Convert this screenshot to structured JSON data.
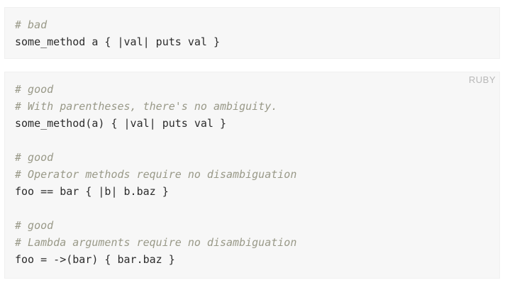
{
  "blocks": [
    {
      "lines": [
        {
          "kind": "comment",
          "text": "# bad"
        },
        {
          "kind": "code",
          "text": "some_method a { |val| puts val }"
        }
      ]
    },
    {
      "language_label": "RUBY",
      "lines": [
        {
          "kind": "comment",
          "text": "# good"
        },
        {
          "kind": "comment",
          "text": "# With parentheses, there's no ambiguity."
        },
        {
          "kind": "code",
          "text": "some_method(a) { |val| puts val }"
        },
        {
          "kind": "blank",
          "text": ""
        },
        {
          "kind": "comment",
          "text": "# good"
        },
        {
          "kind": "comment",
          "text": "# Operator methods require no disambiguation"
        },
        {
          "kind": "code",
          "text": "foo == bar { |b| b.baz }"
        },
        {
          "kind": "blank",
          "text": ""
        },
        {
          "kind": "comment",
          "text": "# good"
        },
        {
          "kind": "comment",
          "text": "# Lambda arguments require no disambiguation"
        },
        {
          "kind": "code",
          "text": "foo = ->(bar) { bar.baz }"
        }
      ]
    }
  ]
}
